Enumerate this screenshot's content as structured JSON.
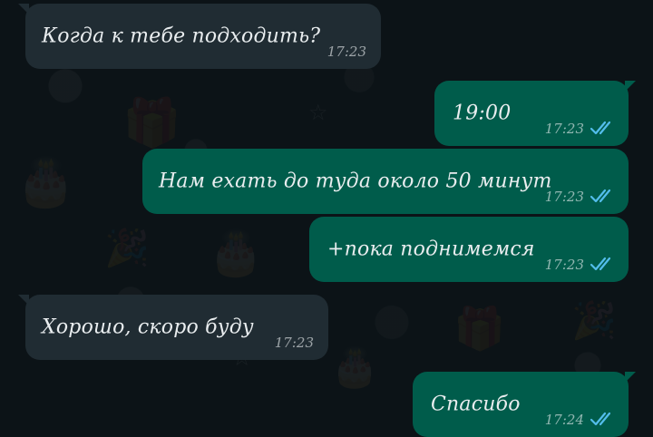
{
  "chat": {
    "theme": {
      "background": "#0c1317",
      "incoming_bubble": "#202c33",
      "outgoing_bubble": "#005c4b",
      "read_check": "#53bdeb",
      "text": "#e9edef"
    },
    "messages": [
      {
        "direction": "incoming",
        "text": "Когда к тебе подходить?",
        "time": "17:23"
      },
      {
        "direction": "outgoing",
        "text": "19:00",
        "time": "17:23",
        "status": "read-double-check-icon"
      },
      {
        "direction": "outgoing",
        "text": "Нам ехать до туда около 50 минут",
        "time": "17:23",
        "status": "read-double-check-icon"
      },
      {
        "direction": "outgoing",
        "text": "+пока поднимемся",
        "time": "17:23",
        "status": "read-double-check-icon"
      },
      {
        "direction": "incoming",
        "text": "Хорошо, скоро буду",
        "time": "17:23"
      },
      {
        "direction": "outgoing",
        "text": "Спасибо",
        "time": "17:24",
        "status": "read-double-check-icon"
      }
    ]
  }
}
